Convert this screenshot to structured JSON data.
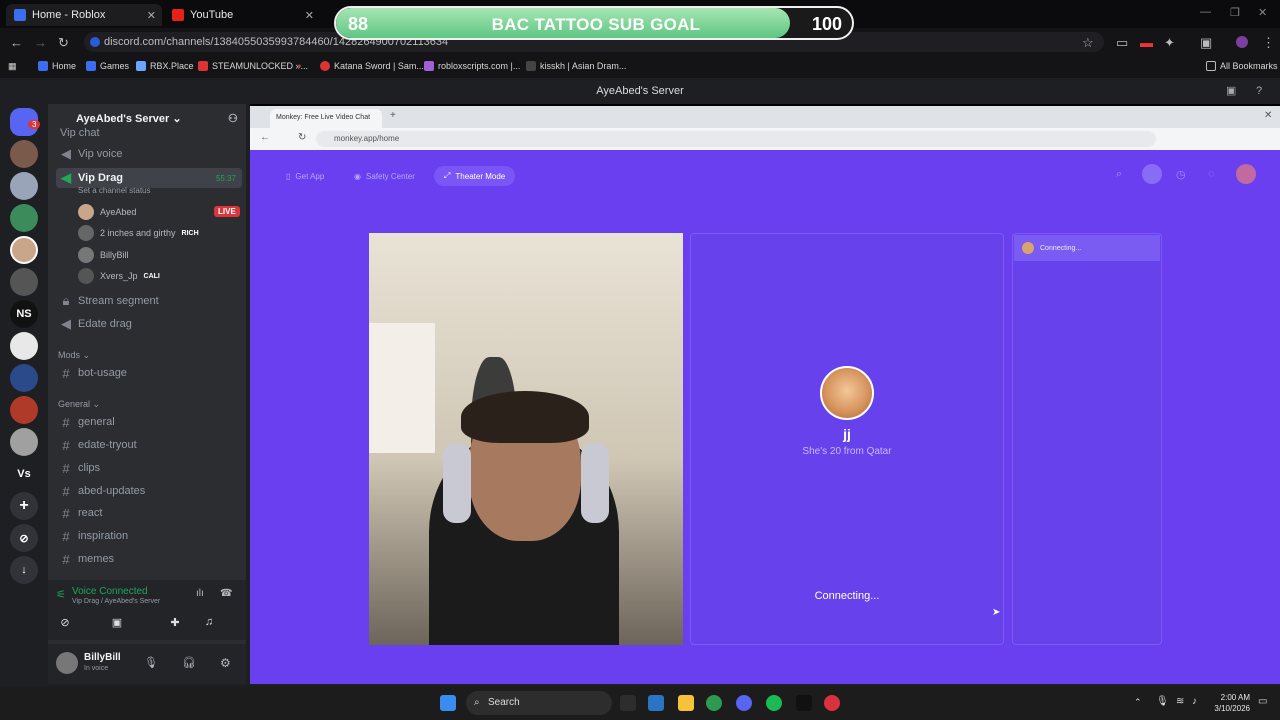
{
  "browser": {
    "tabs": [
      {
        "label": "Home - Roblox"
      },
      {
        "label": "YouTube"
      }
    ],
    "url": "discord.com/channels/1384055035993784460/1428264900702113634",
    "bookmarks": [
      "Home",
      "Games",
      "RBX.Place",
      "STEAMUNLOCKED »...",
      "Katana Sword | Sam...",
      "robloxscripts.com |...",
      "kisskh | Asian Dram...",
      "All Bookmarks"
    ]
  },
  "overlay": {
    "current": "88",
    "title": "BAC TATTOO SUB GOAL",
    "target": "100",
    "progress": 0.88
  },
  "discord": {
    "title": "AyeAbed's Server",
    "server_name": "AyeAbed's Server",
    "channels": {
      "top_partial": "Vip chat",
      "vip_voice": "Vip voice",
      "vip_drag": "Vip Drag",
      "vip_drag_timer": "55:37",
      "status_hint": "Set a channel status",
      "stream_segment": "Stream segment",
      "edate_drag": "Edate drag",
      "mods_category": "Mods",
      "bot_usage": "bot-usage",
      "general_category": "General",
      "general": "general",
      "edate_tryout": "edate-tryout",
      "clips": "clips",
      "abed_updates": "abed-updates",
      "react": "react",
      "inspiration": "inspiration",
      "memes": "memes"
    },
    "members": [
      {
        "name": "AyeAbed",
        "badge": "LIVE"
      },
      {
        "name": "2 inches and girthy",
        "badge": "RICH"
      },
      {
        "name": "BillyBill",
        "badge": ""
      },
      {
        "name": "Xvers_Jp",
        "badge": "CALI"
      }
    ],
    "voice": {
      "status": "Voice Connected",
      "location": "Vip Drag / AyeAbed's Server"
    },
    "user": {
      "name": "BillyBill",
      "status": "In voice"
    },
    "rail": [
      "NS",
      "Vs"
    ],
    "mention_count": "3"
  },
  "stream": {
    "inner_tab": "Monkey: Free Live Video Chat",
    "inner_url": "monkey.app/home",
    "nav": [
      "Get App",
      "Safety Center",
      "Theater Mode"
    ],
    "peer_name": "jj",
    "peer_info": "She's 20 from Qatar",
    "connecting": "Connecting...",
    "side_connecting": "Connecting..."
  },
  "taskbar": {
    "search": "Search",
    "time": "2:00 AM",
    "date": "3/10/2026"
  },
  "colors": {
    "monkey_purple": "#6a3ff0",
    "discord_bg": "#2b2d31",
    "goal_fill": "#5fc682",
    "live_red": "#da373c"
  }
}
